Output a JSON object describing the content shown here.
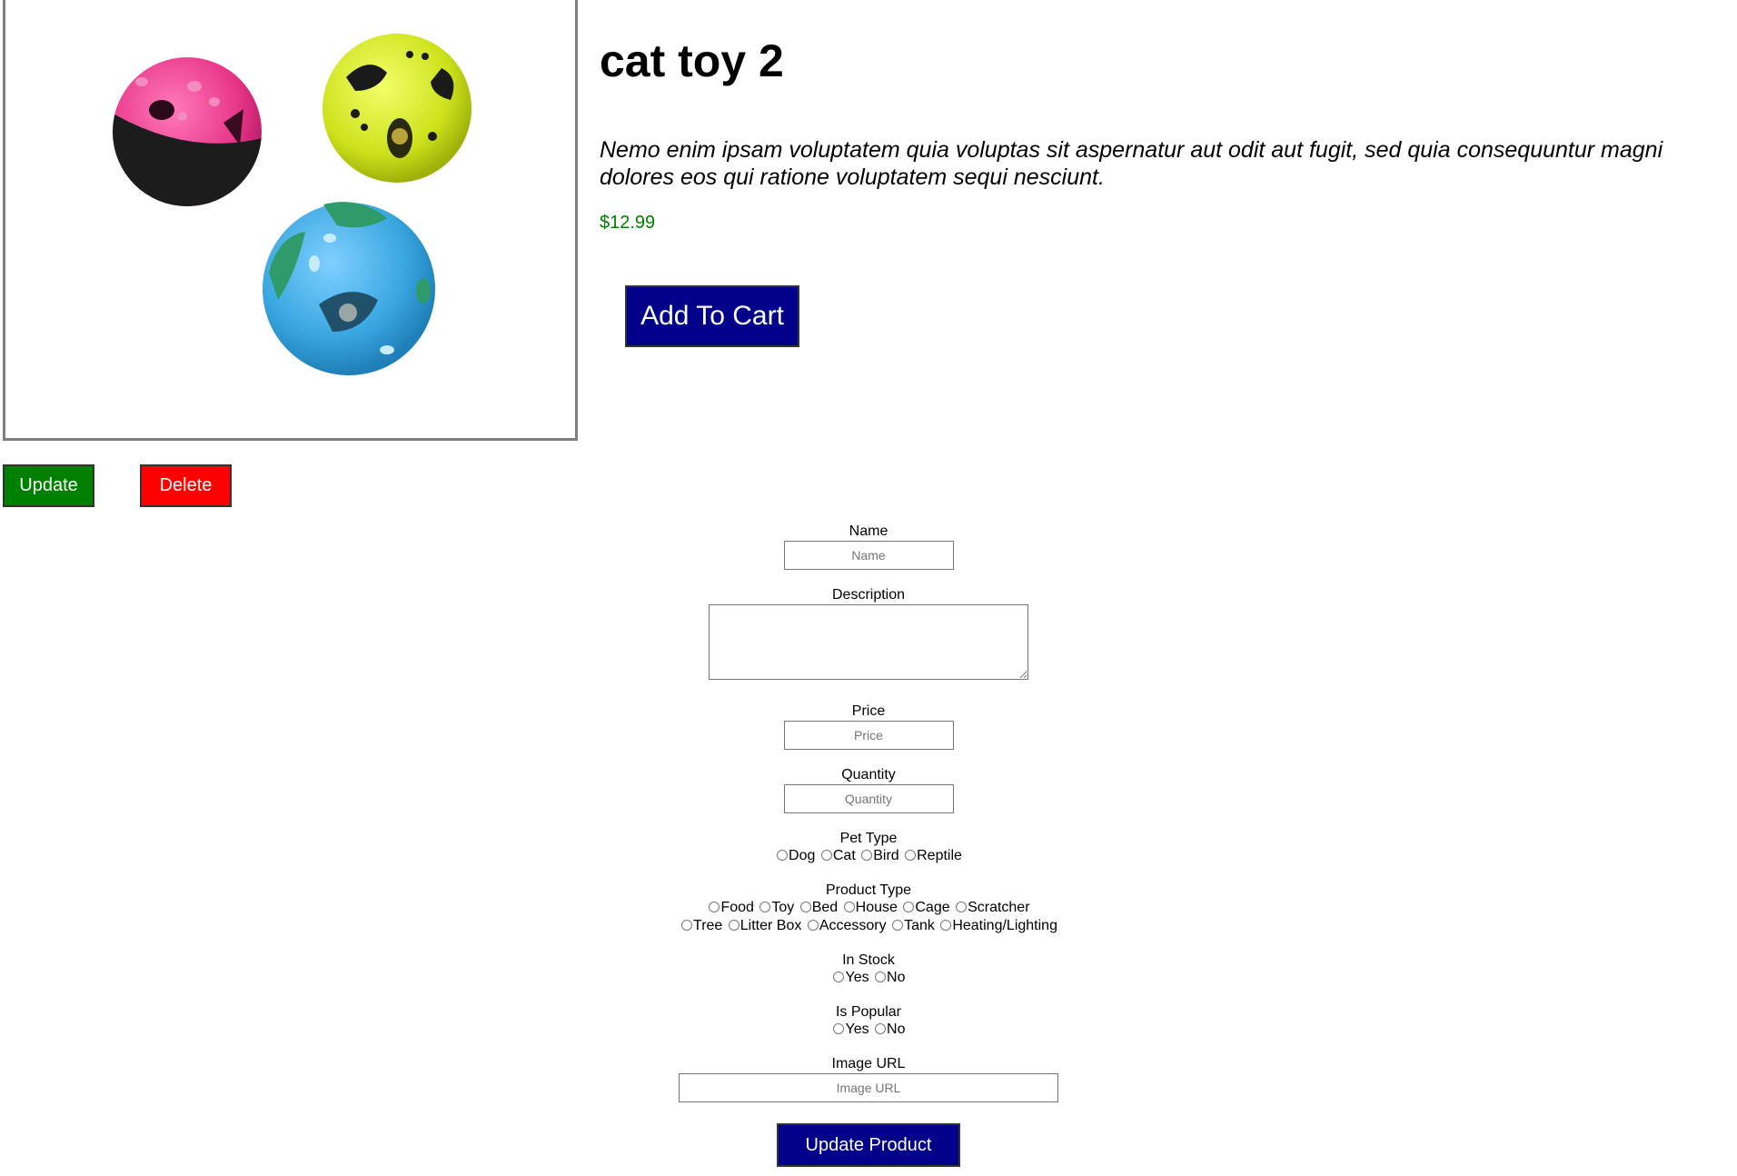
{
  "product": {
    "title": "cat toy 2",
    "description": "Nemo enim ipsam voluptatem quia voluptas sit aspernatur aut odit aut fugit, sed quia consequuntur magni dolores eos qui ratione voluptatem sequi nesciunt.",
    "price": "$12.99",
    "add_to_cart_label": "Add To Cart",
    "image_subject": "three plastic cat ball toys (pink/black, lime green, blue)"
  },
  "actions": {
    "update_label": "Update",
    "delete_label": "Delete"
  },
  "form": {
    "name": {
      "label": "Name",
      "placeholder": "Name"
    },
    "description": {
      "label": "Description"
    },
    "price": {
      "label": "Price",
      "placeholder": "Price"
    },
    "quantity": {
      "label": "Quantity",
      "placeholder": "Quantity"
    },
    "pet_type": {
      "label": "Pet Type",
      "options": [
        "Dog",
        "Cat",
        "Bird",
        "Reptile"
      ]
    },
    "product_type": {
      "label": "Product Type",
      "options": [
        "Food",
        "Toy",
        "Bed",
        "House",
        "Cage",
        "Scratcher",
        "Tree",
        "Litter Box",
        "Accessory",
        "Tank",
        "Heating/Lighting"
      ]
    },
    "in_stock": {
      "label": "In Stock",
      "options": [
        "Yes",
        "No"
      ]
    },
    "is_popular": {
      "label": "Is Popular",
      "options": [
        "Yes",
        "No"
      ]
    },
    "image_url": {
      "label": "Image URL",
      "placeholder": "Image URL"
    },
    "submit_label": "Update Product"
  },
  "colors": {
    "cart_button": "#00008b",
    "update_button": "#008000",
    "delete_button": "#ff0000",
    "price_text": "#008000"
  }
}
